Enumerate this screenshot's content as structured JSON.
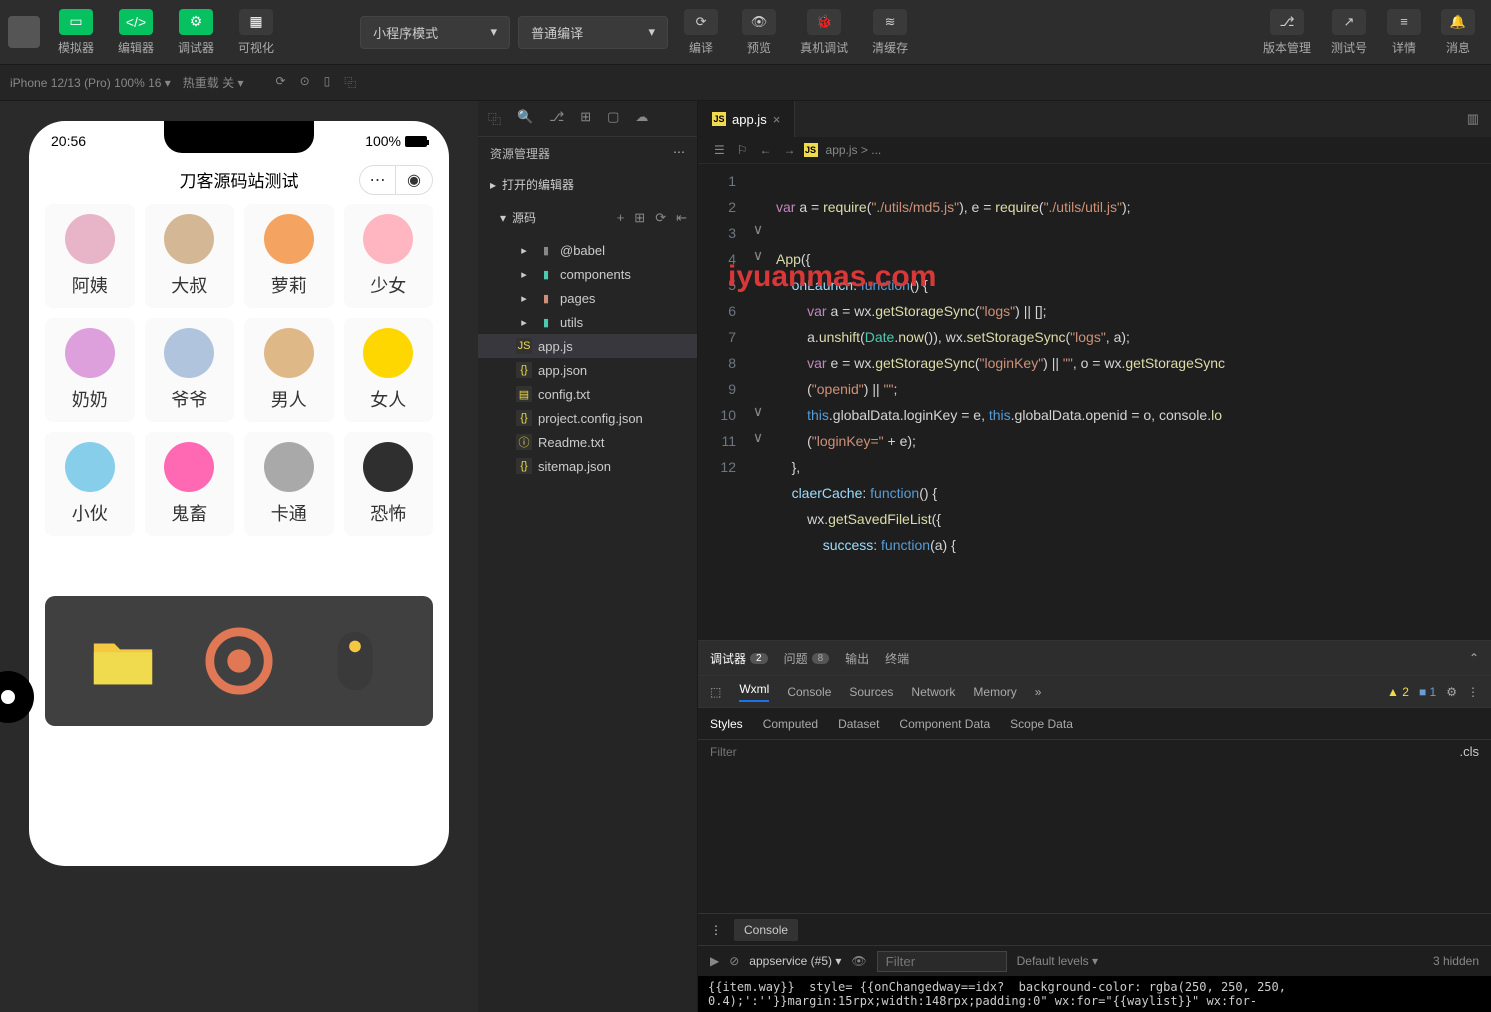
{
  "topbar": {
    "tabs": [
      {
        "label": "模拟器",
        "glyph": "▭"
      },
      {
        "label": "编辑器",
        "glyph": "</>"
      },
      {
        "label": "调试器",
        "glyph": "⚙"
      },
      {
        "label": "可视化",
        "glyph": "▦"
      }
    ],
    "mode_dropdown": "小程序模式",
    "compile_dropdown": "普通编译",
    "actions": [
      {
        "label": "编译",
        "glyph": "⟳"
      },
      {
        "label": "预览",
        "glyph": "👁"
      },
      {
        "label": "真机调试",
        "glyph": "🐞"
      },
      {
        "label": "清缓存",
        "glyph": "≋"
      }
    ],
    "right": [
      {
        "label": "版本管理",
        "glyph": "⎇"
      },
      {
        "label": "测试号",
        "glyph": "↗"
      },
      {
        "label": "详情",
        "glyph": "≡"
      },
      {
        "label": "消息",
        "glyph": "🔔"
      }
    ]
  },
  "secondbar": {
    "device": "iPhone 12/13 (Pro) 100% 16 ▾",
    "hotreload": "热重载 关 ▾"
  },
  "phone": {
    "time": "20:56",
    "battery": "100%",
    "title": "刀客源码站测试",
    "grid": [
      {
        "label": "阿姨",
        "color": "#e8b4c8"
      },
      {
        "label": "大叔",
        "color": "#d4b896"
      },
      {
        "label": "萝莉",
        "color": "#f4a460"
      },
      {
        "label": "少女",
        "color": "#ffb6c1"
      },
      {
        "label": "奶奶",
        "color": "#dda0dd"
      },
      {
        "label": "爷爷",
        "color": "#b0c4de"
      },
      {
        "label": "男人",
        "color": "#deb887"
      },
      {
        "label": "女人",
        "color": "#ffd700"
      },
      {
        "label": "小伙",
        "color": "#87ceeb"
      },
      {
        "label": "鬼畜",
        "color": "#ff69b4"
      },
      {
        "label": "卡通",
        "color": "#a9a9a9"
      },
      {
        "label": "恐怖",
        "color": "#2f2f2f"
      }
    ]
  },
  "explorer": {
    "title": "资源管理器",
    "open_editors": "打开的编辑器",
    "source": "源码",
    "tree": [
      {
        "name": "@babel",
        "type": "folder",
        "cls": "folder-gray"
      },
      {
        "name": "components",
        "type": "folder",
        "cls": "folder-green"
      },
      {
        "name": "pages",
        "type": "folder",
        "cls": "folder-orange"
      },
      {
        "name": "utils",
        "type": "folder",
        "cls": "folder-teal"
      },
      {
        "name": "app.js",
        "type": "file",
        "icon": "JS",
        "selected": true
      },
      {
        "name": "app.json",
        "type": "file",
        "icon": "{}"
      },
      {
        "name": "config.txt",
        "type": "file",
        "icon": "▤"
      },
      {
        "name": "project.config.json",
        "type": "file",
        "icon": "{}"
      },
      {
        "name": "Readme.txt",
        "type": "file",
        "icon": "ⓘ"
      },
      {
        "name": "sitemap.json",
        "type": "file",
        "icon": "{}"
      }
    ]
  },
  "editor": {
    "tab": "app.js",
    "breadcrumb": "app.js > ...",
    "lines": [
      "1",
      "2",
      "3",
      "4",
      "5",
      "6",
      "7",
      "8",
      "9",
      "10",
      "11",
      "12"
    ],
    "fold": [
      "",
      "",
      "∨",
      "∨",
      "",
      "",
      "",
      "",
      "",
      "∨",
      "∨",
      ""
    ],
    "watermark": "iyuanmas.com"
  },
  "code": {
    "l1a": "var",
    "l1b": " a = ",
    "l1c": "require",
    "l1d": "(",
    "l1e": "\"./utils/md5.js\"",
    "l1f": "), e = ",
    "l1g": "require",
    "l1h": "(",
    "l1i": "\"./utils/util.js\"",
    "l1j": ");",
    "l3a": "App",
    "l3b": "({",
    "l4a": "onLaunch",
    "l4b": ": ",
    "l4c": "function",
    "l4d": "() {",
    "l5a": "var",
    "l5b": " a = wx.",
    "l5c": "getStorageSync",
    "l5d": "(",
    "l5e": "\"logs\"",
    "l5f": ") || [];",
    "l6a": "a.",
    "l6b": "unshift",
    "l6c": "(",
    "l6d": "Date",
    "l6e": ".",
    "l6f": "now",
    "l6g": "()), wx.",
    "l6h": "setStorageSync",
    "l6i": "(",
    "l6j": "\"logs\"",
    "l6k": ", a);",
    "l7a": "var",
    "l7b": " e = wx.",
    "l7c": "getStorageSync",
    "l7d": "(",
    "l7e": "\"loginKey\"",
    "l7f": ") || ",
    "l7g": "\"\"",
    "l7h": ", o = wx.",
    "l7i": "getStorageSync",
    "l7_2a": "(",
    "l7_2b": "\"openid\"",
    "l7_2c": ") || ",
    "l7_2d": "\"\"",
    "l7_2e": ";",
    "l8a": "this",
    "l8b": ".globalData.loginKey = e, ",
    "l8c": "this",
    "l8d": ".globalData.openid = o, console.",
    "l8e": "lo",
    "l8_2a": "(",
    "l8_2b": "\"loginKey=\"",
    "l8_2c": " + e);",
    "l9a": "},",
    "l10a": "claerCache",
    "l10b": ": ",
    "l10c": "function",
    "l10d": "() {",
    "l11a": "wx.",
    "l11b": "getSavedFileList",
    "l11c": "({",
    "l12a": "success",
    "l12b": ": ",
    "l12c": "function",
    "l12d": "(a) {"
  },
  "debugger": {
    "tabs": [
      {
        "label": "调试器",
        "badge": "2",
        "active": true
      },
      {
        "label": "问题",
        "badge": "8"
      },
      {
        "label": "输出"
      },
      {
        "label": "终端"
      }
    ],
    "devtools": [
      "Wxml",
      "Console",
      "Sources",
      "Network",
      "Memory"
    ],
    "devtools_active": "Wxml",
    "warn_count": "2",
    "info_count": "1",
    "styles_tabs": [
      "Styles",
      "Computed",
      "Dataset",
      "Component Data",
      "Scope Data"
    ],
    "styles_active": "Styles",
    "filter": "Filter",
    "cls": ".cls",
    "console": {
      "label": "Console",
      "context": "appservice (#5)",
      "levels": "Default levels ▾",
      "hidden": "3 hidden",
      "filter": "Filter"
    },
    "wxml": "{{item.way}}  style= {{onChangedway==idx?  background-color: rgba(250, 250, 250,\n0.4);':''}}margin:15rpx;width:148rpx;padding:0\" wx:for=\"{{waylist}}\" wx:for-"
  }
}
